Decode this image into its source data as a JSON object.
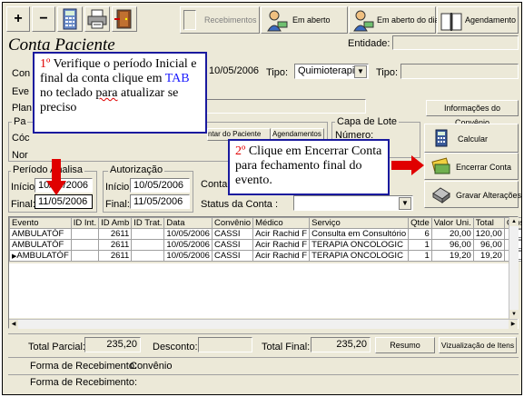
{
  "toolbar": {
    "plus": "+",
    "minus": "−",
    "recebimentos": "Recebimentos",
    "em_aberto": "Em aberto",
    "em_aberto_dia": "Em aberto do dia",
    "agendamento": "Agendamento"
  },
  "title": "Conta Paciente",
  "entidade_label": "Entidade:",
  "row1": {
    "con_label": "Con",
    "date_value": "10/05/2006",
    "tipo_label": "Tipo:",
    "tipo_value": "Quimioterapia",
    "tipo2_label": "Tipo:"
  },
  "side_labels": {
    "eve": "Eve",
    "plan": "Plan",
    "pa": "Pa",
    "coc": "Cóc",
    "nom": "Nor"
  },
  "info_convenio": "Informações do Convênio",
  "capa_lote": {
    "title": "Capa de Lote",
    "numero": "Número:"
  },
  "tabs": {
    "paciente": "ntar do Paciente",
    "agendamentos": "Agendamentos"
  },
  "periodo": {
    "title": "Período Analisa",
    "inicio_label": "Início:",
    "inicio_value": "10/05/2006",
    "final_label": "Final:",
    "final_value": "11/05/2006"
  },
  "autorizacao": {
    "title": "Autorização",
    "inicio_label": "Início:",
    "inicio_value": "10/05/2006",
    "final_label": "Final:",
    "final_value": "11/05/2006"
  },
  "conta_label": "Conta",
  "status_label": "Status da Conta :",
  "buttons": {
    "calcular": "Calcular",
    "encerrar": "Encerrar Conta",
    "gravar": "Gravar Alterações"
  },
  "note1": {
    "step": "1º",
    "text_a": " Verifique o período Inicial e final da conta clique em ",
    "tab": "TAB",
    "text_b": " no teclado ",
    "para": "para",
    "text_c": " atualizar se preciso"
  },
  "note2": {
    "step": "2º",
    "text": " Clique em Encerrar Conta para fechamento final do evento."
  },
  "table": {
    "headers": [
      "Evento",
      "ID Int.",
      "ID Amb",
      "ID Trat.",
      "Data",
      "Convênio",
      "Médico",
      "Serviço",
      "Qtde",
      "Valor Uni.",
      "Total",
      "Glosa"
    ],
    "rows": [
      [
        "AMBULATÓF",
        "",
        "2611",
        "",
        "10/05/2006",
        "CASSI",
        "Acir Rachid F",
        "Consulta em Consultório",
        "6",
        "20,00",
        "120,00"
      ],
      [
        "AMBULATÓF",
        "",
        "2611",
        "",
        "10/05/2006",
        "CASSI",
        "Acir Rachid F",
        "TERAPIA ONCOLOGIC",
        "1",
        "96,00",
        "96,00"
      ],
      [
        "AMBULATÓF",
        "",
        "2611",
        "",
        "10/05/2006",
        "CASSI",
        "Acir Rachid F",
        "TERAPIA ONCOLOGIC",
        "1",
        "19,20",
        "19,20"
      ]
    ]
  },
  "totals": {
    "parcial_label": "Total Parcial:",
    "parcial_value": "235,20",
    "desconto_label": "Desconto:",
    "final_label": "Total Final:",
    "final_value": "235,20",
    "resumo": "Resumo",
    "visualizacao": "Vizualização de Itens"
  },
  "forma1": {
    "label": "Forma de Recebimento:",
    "value": "Convênio"
  },
  "forma2": {
    "label": "Forma de Recebimento:"
  }
}
